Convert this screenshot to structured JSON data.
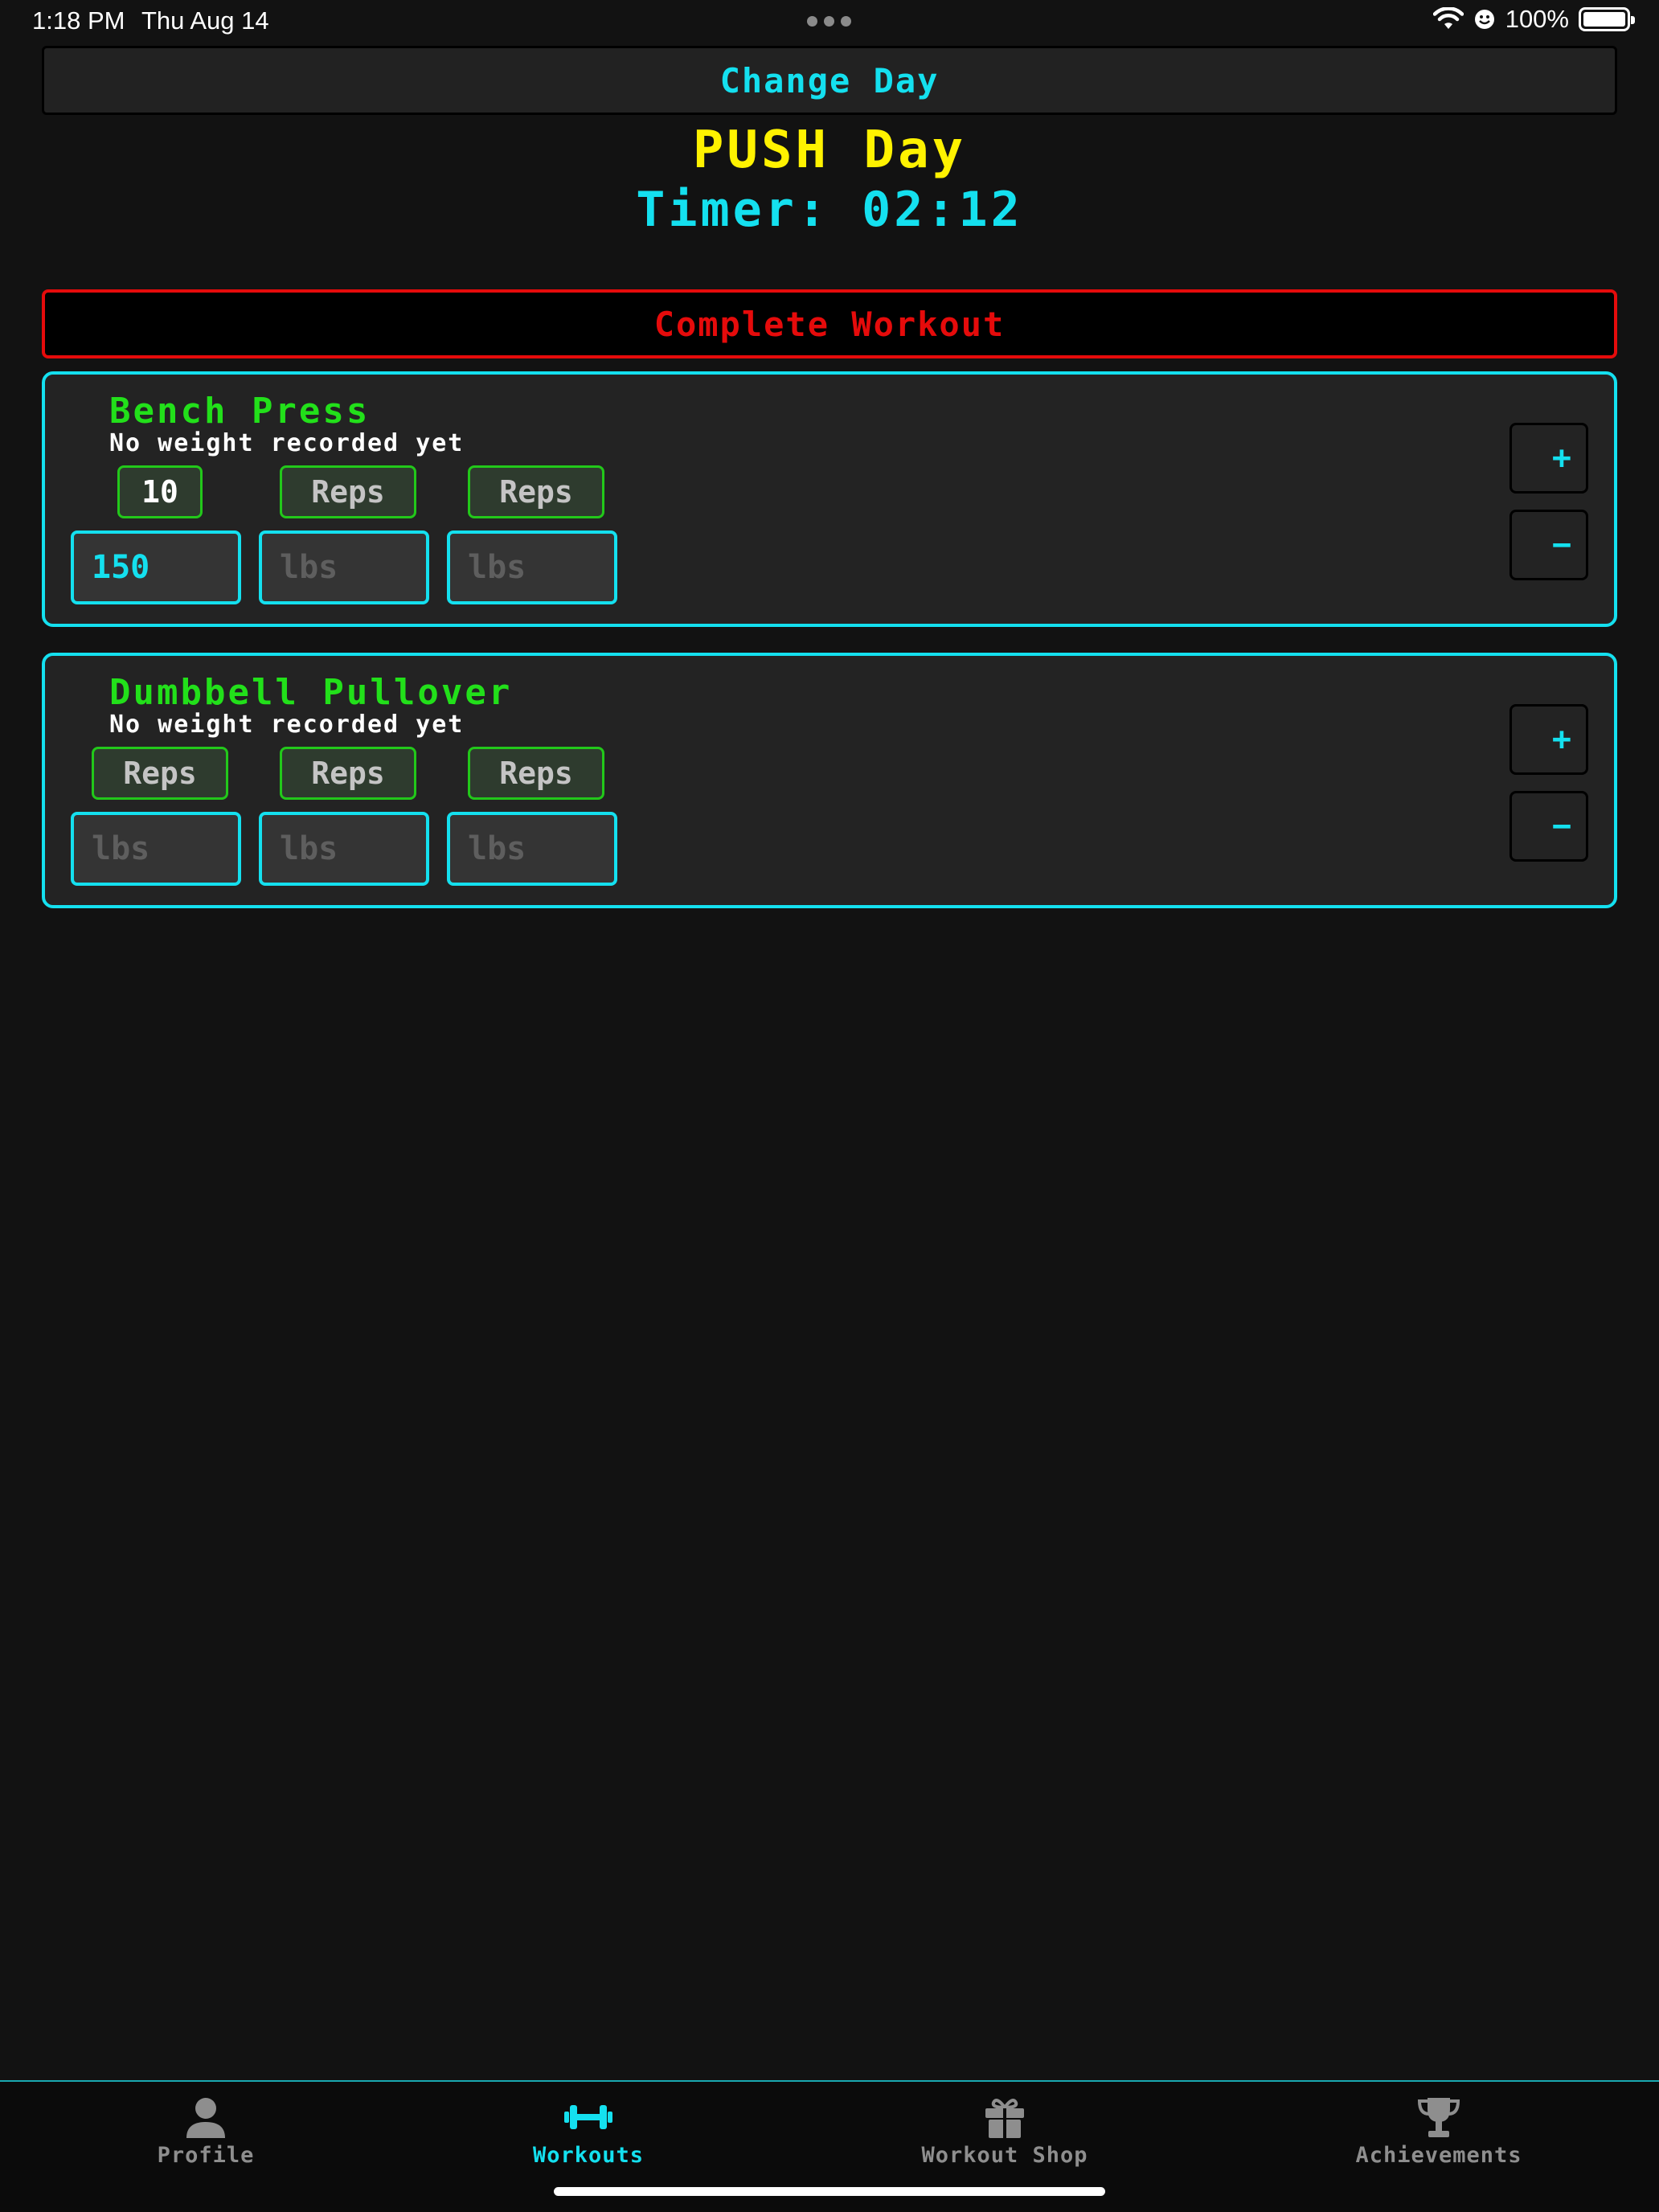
{
  "status_bar": {
    "time": "1:18 PM",
    "date": "Thu Aug 14",
    "battery_percent": "100%",
    "icons": [
      "wifi-icon",
      "focus-icon",
      "battery-icon"
    ]
  },
  "header": {
    "change_day_label": "Change Day",
    "day_title": "PUSH Day",
    "timer_label": "Timer:",
    "timer_value": "02:12"
  },
  "complete_workout_label": "Complete Workout",
  "exercises": [
    {
      "name": "Bench Press",
      "subtitle": "No weight recorded yet",
      "sets": [
        {
          "reps": "10",
          "reps_placeholder": "Reps",
          "weight": "150",
          "weight_placeholder": "lbs"
        },
        {
          "reps": "",
          "reps_placeholder": "Reps",
          "weight": "",
          "weight_placeholder": "lbs"
        },
        {
          "reps": "",
          "reps_placeholder": "Reps",
          "weight": "",
          "weight_placeholder": "lbs"
        }
      ],
      "add_label": "+",
      "remove_label": "−"
    },
    {
      "name": "Dumbbell Pullover",
      "subtitle": "No weight recorded yet",
      "sets": [
        {
          "reps": "",
          "reps_placeholder": "Reps",
          "weight": "",
          "weight_placeholder": "lbs"
        },
        {
          "reps": "",
          "reps_placeholder": "Reps",
          "weight": "",
          "weight_placeholder": "lbs"
        },
        {
          "reps": "",
          "reps_placeholder": "Reps",
          "weight": "",
          "weight_placeholder": "lbs"
        }
      ],
      "add_label": "+",
      "remove_label": "−"
    }
  ],
  "tab_bar": {
    "tabs": [
      {
        "label": "Profile",
        "icon": "person-icon",
        "active": false
      },
      {
        "label": "Workouts",
        "icon": "dumbbell-icon",
        "active": true
      },
      {
        "label": "Workout Shop",
        "icon": "gift-icon",
        "active": false
      },
      {
        "label": "Achievements",
        "icon": "trophy-icon",
        "active": false
      }
    ]
  },
  "colors": {
    "accent_cyan": "#14e0ef",
    "title_yellow": "#fff200",
    "exercise_green": "#22e01a",
    "danger_red": "#e50b0b",
    "background": "#121212",
    "card": "#232323"
  }
}
